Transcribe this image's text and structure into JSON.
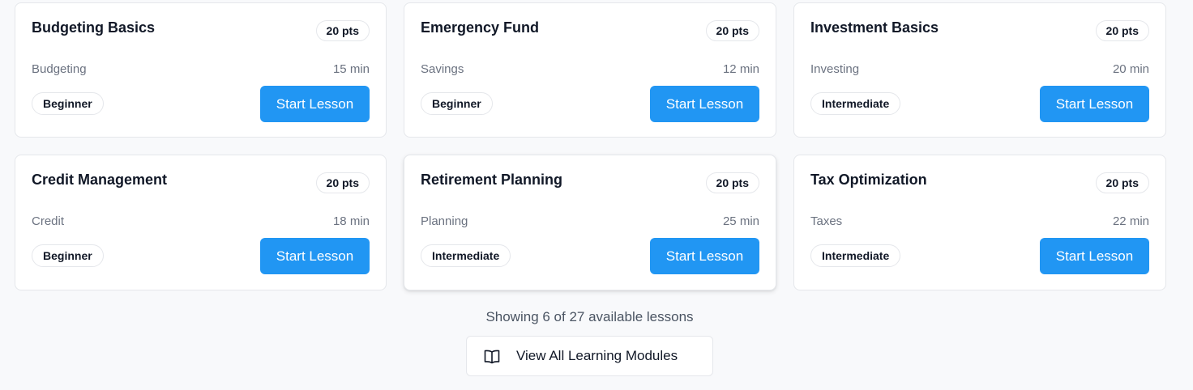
{
  "lessons": [
    {
      "title": "Budgeting Basics",
      "points": "20 pts",
      "category": "Budgeting",
      "duration": "15 min",
      "level": "Beginner",
      "action": "Start Lesson"
    },
    {
      "title": "Emergency Fund",
      "points": "20 pts",
      "category": "Savings",
      "duration": "12 min",
      "level": "Beginner",
      "action": "Start Lesson"
    },
    {
      "title": "Investment Basics",
      "points": "20 pts",
      "category": "Investing",
      "duration": "20 min",
      "level": "Intermediate",
      "action": "Start Lesson"
    },
    {
      "title": "Credit Management",
      "points": "20 pts",
      "category": "Credit",
      "duration": "18 min",
      "level": "Beginner",
      "action": "Start Lesson"
    },
    {
      "title": "Retirement Planning",
      "points": "20 pts",
      "category": "Planning",
      "duration": "25 min",
      "level": "Intermediate",
      "action": "Start Lesson"
    },
    {
      "title": "Tax Optimization",
      "points": "20 pts",
      "category": "Taxes",
      "duration": "22 min",
      "level": "Intermediate",
      "action": "Start Lesson"
    }
  ],
  "summary": "Showing 6 of 27 available lessons",
  "view_all": {
    "label": "View All Learning Modules",
    "icon": "book-open-icon"
  },
  "colors": {
    "accent": "#2196f3",
    "border": "#e5e7eb",
    "muted": "#6b7280"
  }
}
